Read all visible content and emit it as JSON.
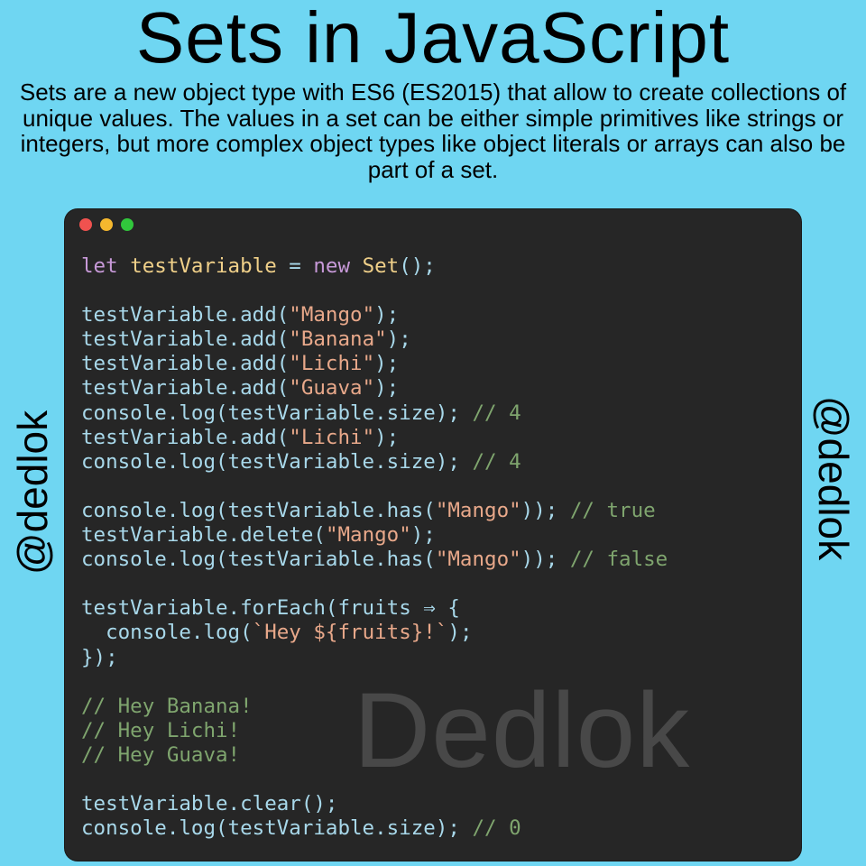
{
  "title": "Sets in JavaScript",
  "intro": "Sets are a new object type with ES6 (ES2015) that allow to create collections of unique values. The values in a set can be either simple primitives like strings or integers, but more complex object types like object literals or arrays can also be part of a set.",
  "handle_left": "@dedlok",
  "handle_right": "@dedlok",
  "watermark": "Dedlok",
  "window_buttons": [
    "red",
    "yellow",
    "green"
  ],
  "code_lines": [
    [
      {
        "t": "let",
        "c": "kw"
      },
      {
        "t": " ",
        "c": "txt"
      },
      {
        "t": "testVariable",
        "c": "id"
      },
      {
        "t": " = ",
        "c": "txt"
      },
      {
        "t": "new",
        "c": "kw"
      },
      {
        "t": " ",
        "c": "txt"
      },
      {
        "t": "Set",
        "c": "id"
      },
      {
        "t": "();",
        "c": "txt"
      }
    ],
    [],
    [
      {
        "t": "testVariable.add(",
        "c": "txt"
      },
      {
        "t": "\"Mango\"",
        "c": "str"
      },
      {
        "t": ");",
        "c": "txt"
      }
    ],
    [
      {
        "t": "testVariable.add(",
        "c": "txt"
      },
      {
        "t": "\"Banana\"",
        "c": "str"
      },
      {
        "t": ");",
        "c": "txt"
      }
    ],
    [
      {
        "t": "testVariable.add(",
        "c": "txt"
      },
      {
        "t": "\"Lichi\"",
        "c": "str"
      },
      {
        "t": ");",
        "c": "txt"
      }
    ],
    [
      {
        "t": "testVariable.add(",
        "c": "txt"
      },
      {
        "t": "\"Guava\"",
        "c": "str"
      },
      {
        "t": ");",
        "c": "txt"
      }
    ],
    [
      {
        "t": "console.log(testVariable.size); ",
        "c": "txt"
      },
      {
        "t": "// 4",
        "c": "cm"
      }
    ],
    [
      {
        "t": "testVariable.add(",
        "c": "txt"
      },
      {
        "t": "\"Lichi\"",
        "c": "str"
      },
      {
        "t": ");",
        "c": "txt"
      }
    ],
    [
      {
        "t": "console.log(testVariable.size); ",
        "c": "txt"
      },
      {
        "t": "// 4",
        "c": "cm"
      }
    ],
    [],
    [
      {
        "t": "console.log(testVariable.has(",
        "c": "txt"
      },
      {
        "t": "\"Mango\"",
        "c": "str"
      },
      {
        "t": ")); ",
        "c": "txt"
      },
      {
        "t": "// true",
        "c": "cm"
      }
    ],
    [
      {
        "t": "testVariable.delete(",
        "c": "txt"
      },
      {
        "t": "\"Mango\"",
        "c": "str"
      },
      {
        "t": ");",
        "c": "txt"
      }
    ],
    [
      {
        "t": "console.log(testVariable.has(",
        "c": "txt"
      },
      {
        "t": "\"Mango\"",
        "c": "str"
      },
      {
        "t": ")); ",
        "c": "txt"
      },
      {
        "t": "// false",
        "c": "cm"
      }
    ],
    [],
    [
      {
        "t": "testVariable.forEach(fruits ⇒ {",
        "c": "txt"
      }
    ],
    [
      {
        "t": "  console.log(",
        "c": "txt"
      },
      {
        "t": "`Hey ${fruits}!`",
        "c": "str"
      },
      {
        "t": ");",
        "c": "txt"
      }
    ],
    [
      {
        "t": "});",
        "c": "txt"
      }
    ],
    [],
    [
      {
        "t": "// Hey Banana!",
        "c": "cm"
      }
    ],
    [
      {
        "t": "// Hey Lichi!",
        "c": "cm"
      }
    ],
    [
      {
        "t": "// Hey Guava!",
        "c": "cm"
      }
    ],
    [],
    [
      {
        "t": "testVariable.clear();",
        "c": "txt"
      }
    ],
    [
      {
        "t": "console.log(testVariable.size); ",
        "c": "txt"
      },
      {
        "t": "// 0",
        "c": "cm"
      }
    ]
  ]
}
